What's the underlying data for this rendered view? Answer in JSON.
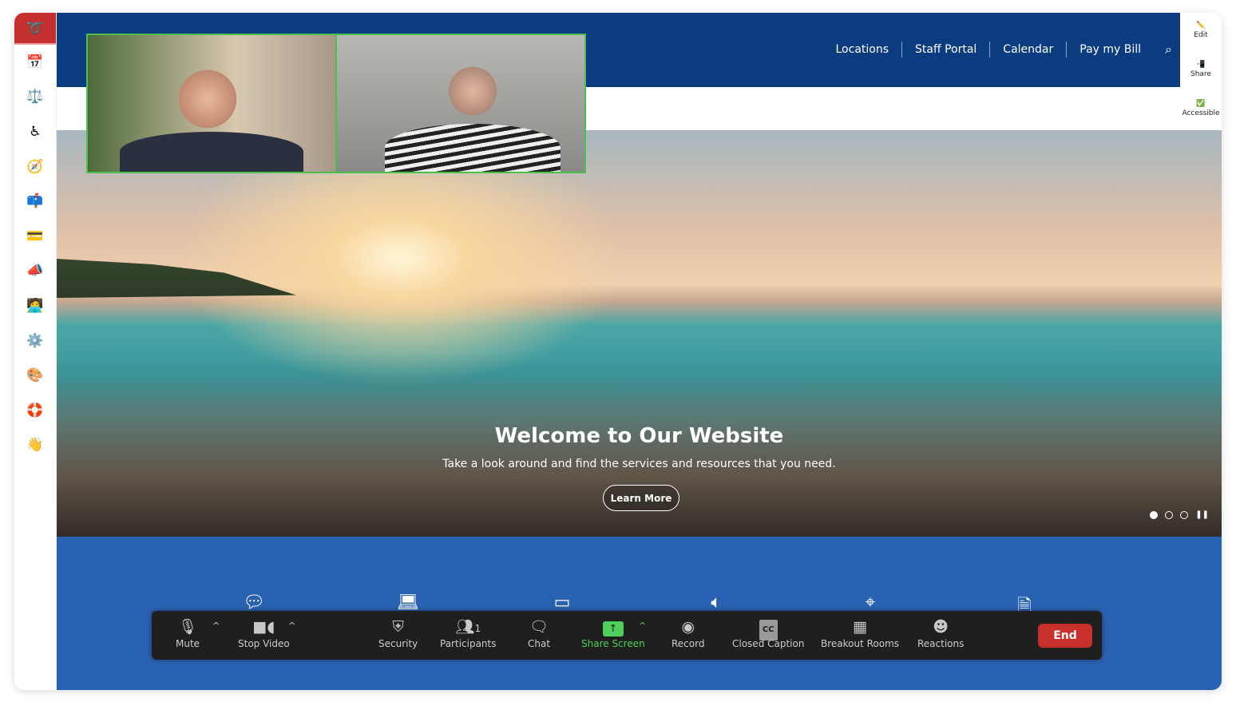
{
  "sidebar": {
    "logo": "logo",
    "icons": [
      "calendar-icon",
      "scales-icon",
      "accessibility-icon",
      "compass-icon",
      "mailbox-icon",
      "credit-card-icon",
      "megaphone-icon",
      "technologist-icon",
      "gear-icon",
      "palette-icon",
      "lifebuoy-icon",
      "waving-hand-icon"
    ],
    "glyphs": [
      "📅",
      "⚖️",
      "♿",
      "🧭",
      "📫",
      "💳",
      "📣",
      "🧑‍💻",
      "⚙️",
      "🎨",
      "🛟",
      "👋"
    ]
  },
  "header": {
    "nav": [
      "Locations",
      "Staff Portal",
      "Calendar",
      "Pay my Bill"
    ],
    "search_icon": "🔍"
  },
  "right_panel": [
    {
      "icon": "✏️",
      "label": "Edit"
    },
    {
      "icon": "📲",
      "label": "Share"
    },
    {
      "icon": "✅",
      "label": "Accessible"
    }
  ],
  "hero": {
    "title": "Welcome to Our Website",
    "subtitle": "Take a look around and find the services and resources that you need.",
    "button": "Learn More",
    "slides": 3,
    "active_slide": 1
  },
  "band_icons": [
    "chat-bubble-icon",
    "laptop-icon",
    "browser-window-icon",
    "speaker-icon",
    "map-pin-icon",
    "document-icon"
  ],
  "toolbar": {
    "mute": "Mute",
    "stop_video": "Stop Video",
    "security": "Security",
    "participants": "Participants",
    "participant_count": "1",
    "chat": "Chat",
    "share_screen": "Share Screen",
    "record": "Record",
    "closed_caption": "Closed Caption",
    "cc": "CC",
    "breakout_rooms": "Breakout Rooms",
    "reactions": "Reactions",
    "end": "End"
  },
  "colors": {
    "header": "#0c3c80",
    "band": "#2a62b3",
    "logo": "#c42f2f",
    "share_green": "#4fd05a",
    "end_red": "#c8302c",
    "video_border": "#4cc04c"
  }
}
